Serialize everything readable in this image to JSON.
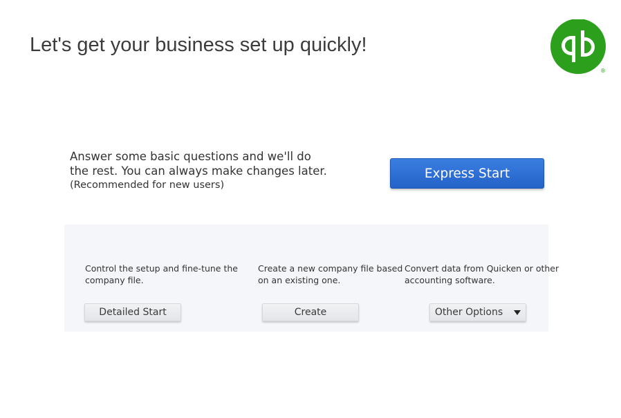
{
  "header": {
    "title": "Let's get your business set up quickly!"
  },
  "brand": {
    "logo_icon": "quickbooks-logo-icon",
    "logo_color": "#2ca01c",
    "registered_mark": "®"
  },
  "express": {
    "desc_line1": "Answer some basic questions and we'll do",
    "desc_line2": "the rest. You can always make changes later.",
    "recommended": "(Recommended for new users)",
    "button_label": "Express Start",
    "button_color": "#2d6fd6"
  },
  "options": {
    "detailed": {
      "desc_line1": "Control the setup and fine-tune the",
      "desc_line2": "company file.",
      "button_label": "Detailed Start"
    },
    "create": {
      "desc_line1": "Create a new company file based",
      "desc_line2": "on an existing one.",
      "button_label": "Create"
    },
    "other": {
      "desc_line1": "Convert data from Quicken or other",
      "desc_line2": "accounting software.",
      "button_label": "Other Options",
      "dropdown_icon": "caret-down-icon"
    }
  }
}
